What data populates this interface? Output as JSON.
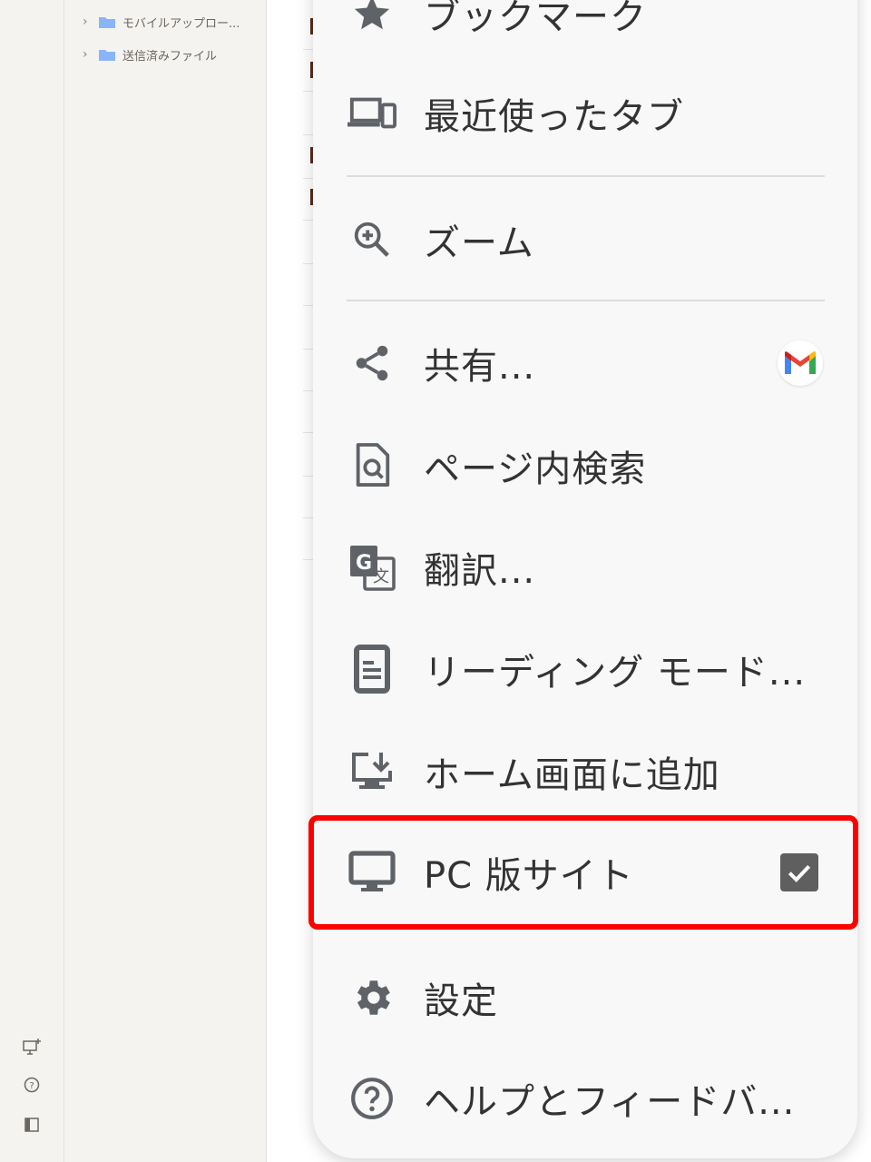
{
  "tree": {
    "items": [
      {
        "label": "モバイルアップロー..."
      },
      {
        "label": "送信済みファイル"
      }
    ]
  },
  "menu": {
    "items": [
      {
        "label": "ブックマーク",
        "icon": "star-icon"
      },
      {
        "label": "最近使ったタブ",
        "icon": "devices-icon"
      },
      {
        "label": "ズーム",
        "icon": "zoom-in-icon"
      },
      {
        "label": "共有...",
        "icon": "share-icon",
        "accessory": "gmail-icon"
      },
      {
        "label": "ページ内検索",
        "icon": "find-in-page-icon"
      },
      {
        "label": "翻訳...",
        "icon": "translate-icon"
      },
      {
        "label": "リーディング モード...",
        "icon": "reading-mode-icon"
      },
      {
        "label": "ホーム画面に追加",
        "icon": "add-to-home-icon"
      },
      {
        "label": "PC 版サイト",
        "icon": "desktop-icon",
        "checked": true
      },
      {
        "label": "設定",
        "icon": "settings-icon"
      },
      {
        "label": "ヘルプとフィードバ...",
        "icon": "help-icon"
      }
    ]
  },
  "colors": {
    "highlight": "#ff0000",
    "icon": "#5f6368",
    "folder": "#8ab4f8"
  }
}
